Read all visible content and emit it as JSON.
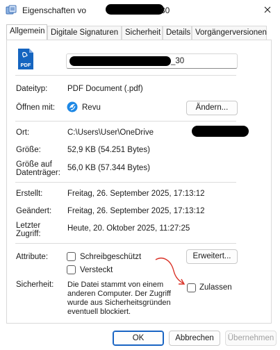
{
  "window": {
    "title": "Eigenschaften vo",
    "title_suffix": "30"
  },
  "tabs": [
    {
      "label": "Allgemein",
      "active": true
    },
    {
      "label": "Digitale Signaturen",
      "active": false
    },
    {
      "label": "Sicherheit",
      "active": false
    },
    {
      "label": "Details",
      "active": false
    },
    {
      "label": "Vorgängerversionen",
      "active": false
    }
  ],
  "general": {
    "filename_visible": "_30",
    "filetype_label": "Dateityp:",
    "filetype_value": "PDF Document (.pdf)",
    "openwith_label": "Öffnen mit:",
    "openwith_value": "Revu",
    "change_button": "Ändern...",
    "location_label": "Ort:",
    "location_value": "C:\\Users\\User\\OneDrive",
    "size_label": "Größe:",
    "size_value": "52,9 KB (54.251 Bytes)",
    "disksize_label_1": "Größe auf",
    "disksize_label_2": "Datenträger:",
    "disksize_value": "56,0 KB (57.344 Bytes)",
    "created_label": "Erstellt:",
    "created_value": "Freitag, 26. September 2025, 17:13:12",
    "modified_label": "Geändert:",
    "modified_value": "Freitag, 26. September 2025, 17:13:12",
    "accessed_label_1": "Letzter",
    "accessed_label_2": "Zugriff:",
    "accessed_value": "Heute, 20. Oktober 2025, 11:27:25",
    "attributes_label": "Attribute:",
    "readonly_label": "Schreibgeschützt",
    "hidden_label": "Versteckt",
    "advanced_button": "Erweitert...",
    "security_label": "Sicherheit:",
    "security_text_1": "Die Datei stammt von einem",
    "security_text_2": "anderen Computer. Der Zugriff",
    "security_text_3": "wurde aus Sicherheitsgründen",
    "security_text_4": "eventuell blockiert.",
    "allow_label": "Zulassen"
  },
  "footer": {
    "ok": "OK",
    "cancel": "Abbrechen",
    "apply": "Übernehmen"
  },
  "icons": {
    "pdf_icon_text": "PDF",
    "accent": "#1a73e8",
    "pdf_color": "#1565c0",
    "annotation_arrow_color": "#d93025"
  }
}
